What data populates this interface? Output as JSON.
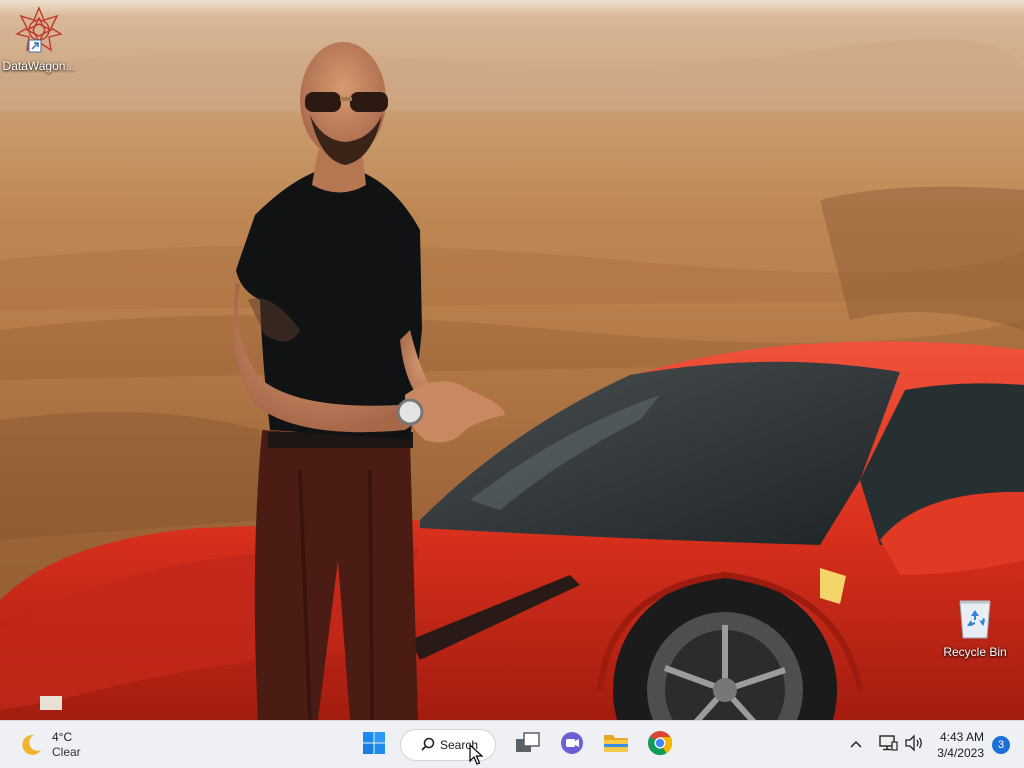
{
  "desktop": {
    "icons": [
      {
        "id": "datawagon",
        "label": "DataWagon...",
        "icon": "datawagon-logo-icon",
        "shortcut": true
      },
      {
        "id": "recycle",
        "label": "Recycle Bin",
        "icon": "recycle-bin-icon"
      }
    ],
    "wallpaper": {
      "description_icon": "photo-wallpaper",
      "accent_car": "#d8301c"
    }
  },
  "taskbar": {
    "weather": {
      "temp": "4°C",
      "condition": "Clear",
      "icon": "crescent-moon-icon"
    },
    "start_icon": "windows-start-icon",
    "search": {
      "label": "Search",
      "icon": "search-icon"
    },
    "pinned": [
      {
        "name": "task-view-icon"
      },
      {
        "name": "teams-chat-icon"
      },
      {
        "name": "file-explorer-icon"
      },
      {
        "name": "chrome-icon"
      }
    ],
    "tray": {
      "chevron": "chevron-up-icon",
      "network": "network-icon",
      "volume": "speaker-icon",
      "time": "4:43 AM",
      "date": "3/4/2023",
      "notification_count": "3"
    }
  },
  "colors": {
    "taskbar_bg": "#eef0f4",
    "accent_blue": "#1b6fd6"
  }
}
